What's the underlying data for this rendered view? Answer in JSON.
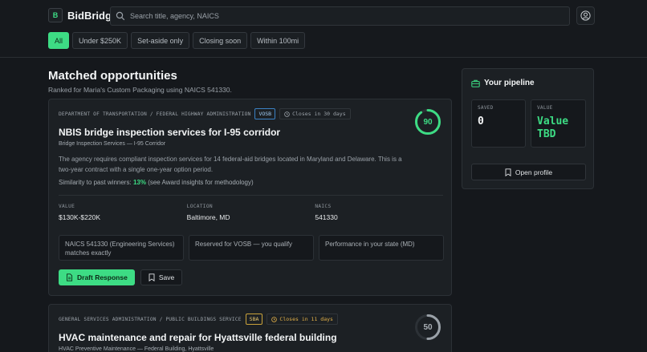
{
  "app": {
    "logo_letter": "B",
    "name": "BidBridge"
  },
  "search": {
    "placeholder": "Search title, agency, NAICS"
  },
  "filters": [
    "All",
    "Under $250K",
    "Set-aside only",
    "Closing soon",
    "Within 100mi"
  ],
  "filters_active_index": 0,
  "main": {
    "heading": "Matched opportunities",
    "subheading": "Ranked for Maria's Custom Packaging using NAICS 541330."
  },
  "opportunities": [
    {
      "agency": "DEPARTMENT OF TRANSPORTATION / FEDERAL HIGHWAY ADMINISTRATION",
      "tag": "VOSB",
      "closes": "Closes in 30 days",
      "score": 90,
      "score_color": "#3ddc84",
      "title": "NBIS bridge inspection services for I-95 corridor",
      "subtitle": "Bridge Inspection Services — I-95 Corridor",
      "description": "The agency requires compliant inspection services for 14 federal-aid bridges located in Maryland and Delaware. This is a two-year contract with a single one-year option period.",
      "similarity_prefix": "Similarity to past winners:",
      "similarity_pct": "13%",
      "similarity_suffix": "(see Award insights for methodology)",
      "facts": [
        {
          "label": "VALUE",
          "value": "$130K-$220K"
        },
        {
          "label": "LOCATION",
          "value": "Baltimore, MD"
        },
        {
          "label": "NAICS",
          "value": "541330"
        }
      ],
      "reasons": [
        "NAICS 541330 (Engineering Services) matches exactly",
        "Reserved for VOSB — you qualify",
        "Performance in your state (MD)"
      ],
      "primary_action": "Draft Response",
      "secondary_action": "Save"
    },
    {
      "agency": "GENERAL SERVICES ADMINISTRATION / PUBLIC BUILDINGS SERVICE",
      "tag": "SBA",
      "closes": "Closes in 11 days",
      "score": 50,
      "score_color": "#9aa1a8",
      "title": "HVAC maintenance and repair for Hyattsville federal building",
      "subtitle": "HVAC Preventive Maintenance — Federal Building, Hyattsville"
    }
  ],
  "pipeline": {
    "title": "Your pipeline",
    "saved_label": "SAVED",
    "saved_value": "0",
    "value_label": "VALUE",
    "value_value": "Value TBD",
    "open_profile": "Open profile"
  },
  "colors": {
    "accent": "#3ddc84",
    "background": "#15181c",
    "card": "#1c2024",
    "warning": "#e2b049"
  }
}
